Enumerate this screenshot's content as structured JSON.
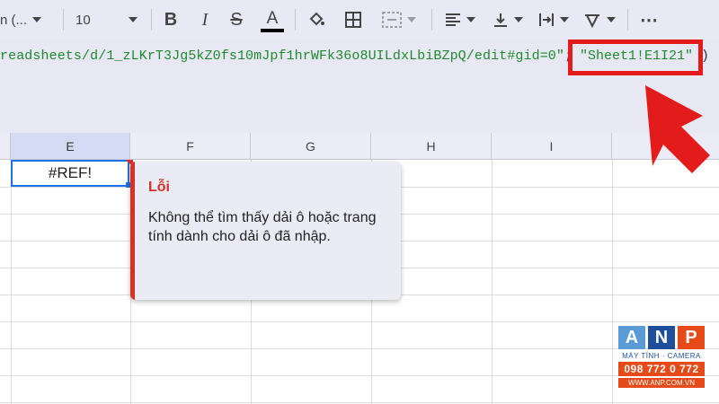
{
  "toolbar": {
    "font_name": "n (...",
    "font_size": "10",
    "bold_icon": "bold-icon",
    "italic_icon": "italic-icon",
    "strike_icon": "strikethrough-icon",
    "text_color_label": "A",
    "text_color": "#000000",
    "more_label": "⋯"
  },
  "formula": {
    "main_text": "readsheets/d/1_zLKrT3Jg5kZ0fs10mJpf1hrWFk36o8UILdxLbiBZpQ/edit#gid=0\"",
    "separator": ";",
    "range_text": "\"Sheet1!E1I21\"",
    "close_paren": ")"
  },
  "columns": [
    "E",
    "F",
    "G",
    "H",
    "I"
  ],
  "cell": {
    "value": "#REF!"
  },
  "error_popup": {
    "title": "Lỗi",
    "message": "Không thể tìm thấy dải ô hoặc trang tính dành cho dải ô đã nhập."
  },
  "watermark": {
    "letters": [
      "A",
      "N",
      "P"
    ],
    "tagline": "MÁY TÍNH · CAMERA",
    "phone": "098 772 0 772",
    "website": "WWW.ANP.COM.VN"
  },
  "colors": {
    "highlight": "#e31b1b",
    "formula_text": "#1e8a2e",
    "error": "#d93025",
    "selection": "#1a73e8"
  }
}
